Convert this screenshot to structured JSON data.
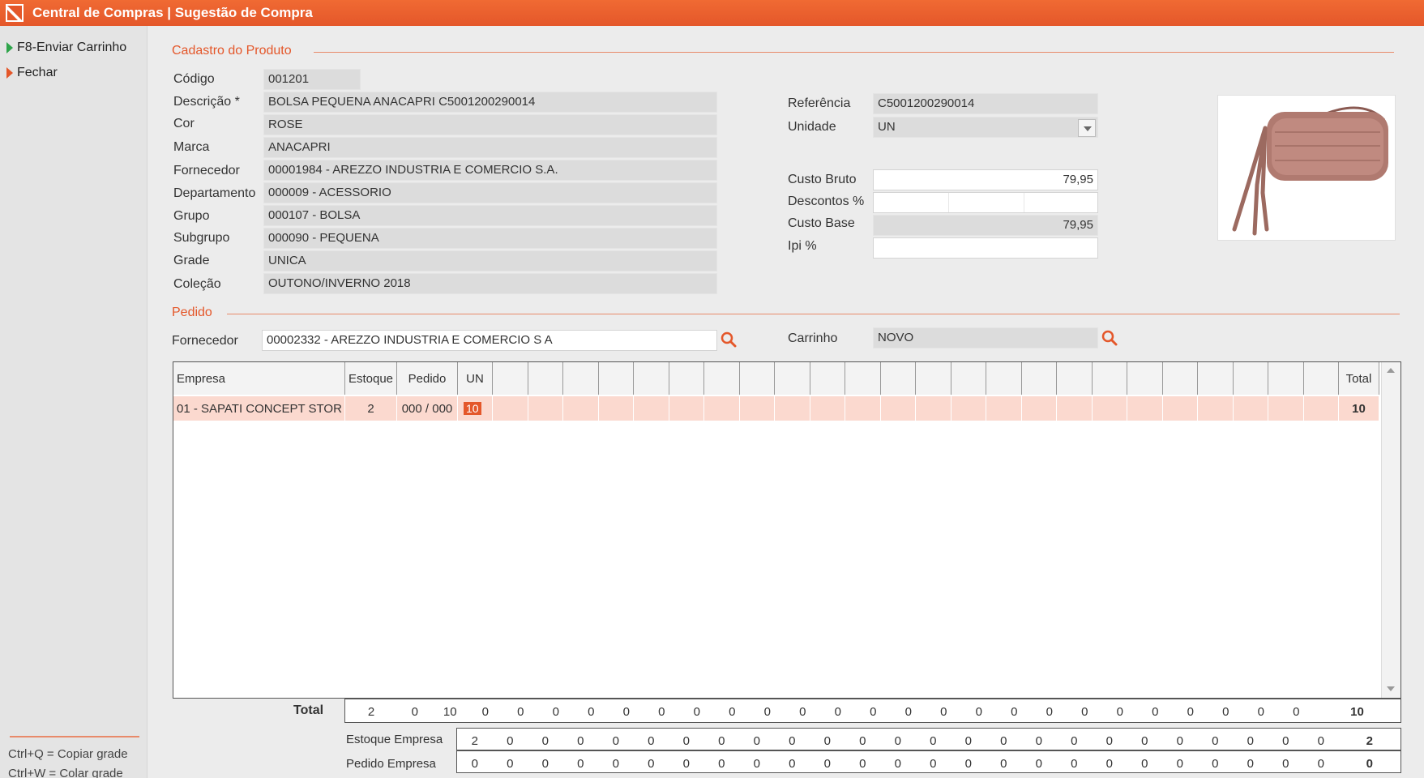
{
  "window": {
    "title": "Central de Compras | Sugestão de Compra"
  },
  "sidebar": {
    "items": [
      {
        "label": "F8-Enviar Carrinho"
      },
      {
        "label": "Fechar"
      }
    ],
    "shortcuts": [
      "Ctrl+Q  = Copiar grade",
      "Ctrl+W = Colar grade"
    ]
  },
  "produto": {
    "section_title": "Cadastro do Produto",
    "codigo_label": "Código",
    "codigo": "001201",
    "descricao_label": "Descrição *",
    "descricao": "BOLSA PEQUENA ANACAPRI C5001200290014",
    "cor_label": "Cor",
    "cor": "ROSE",
    "marca_label": "Marca",
    "marca": "ANACAPRI",
    "fornecedor_label": "Fornecedor",
    "fornecedor": "00001984 - AREZZO INDUSTRIA E COMERCIO S.A.",
    "departamento_label": "Departamento",
    "departamento": "000009 - ACESSORIO",
    "grupo_label": "Grupo",
    "grupo": "000107 - BOLSA",
    "subgrupo_label": "Subgrupo",
    "subgrupo": "000090 - PEQUENA",
    "grade_label": "Grade",
    "grade": "UNICA",
    "colecao_label": "Coleção",
    "colecao": "OUTONO/INVERNO 2018",
    "referencia_label": "Referência",
    "referencia": "C5001200290014",
    "unidade_label": "Unidade",
    "unidade": "UN",
    "custo_bruto_label": "Custo Bruto",
    "custo_bruto": "79,95",
    "descontos_label": "Descontos %",
    "custo_base_label": "Custo Base",
    "custo_base": "79,95",
    "ipi_label": "Ipi %",
    "ipi": ""
  },
  "pedido": {
    "section_title": "Pedido",
    "fornecedor_label": "Fornecedor",
    "fornecedor": "00002332 - AREZZO INDUSTRIA E COMERCIO S A",
    "carrinho_label": "Carrinho",
    "carrinho": "NOVO"
  },
  "grid": {
    "headers": {
      "empresa": "Empresa",
      "estoque": "Estoque",
      "pedido": "Pedido",
      "un": "UN",
      "total": "Total"
    },
    "row": {
      "empresa": "01 - SAPATI CONCEPT STOR",
      "estoque": "2",
      "pedido": "000 / 000",
      "un": "10",
      "total": "10"
    },
    "totals": {
      "label": "Total",
      "values": [
        "2",
        "0",
        "10",
        "0",
        "0",
        "0",
        "0",
        "0",
        "0",
        "0",
        "0",
        "0",
        "0",
        "0",
        "0",
        "0",
        "0",
        "0",
        "0",
        "0",
        "0",
        "0",
        "0",
        "0",
        "0",
        "0",
        "0"
      ],
      "grand_total": "10"
    },
    "estoque_empresa": {
      "label": "Estoque Empresa",
      "values": [
        "2",
        "0",
        "0",
        "0",
        "0",
        "0",
        "0",
        "0",
        "0",
        "0",
        "0",
        "0",
        "0",
        "0",
        "0",
        "0",
        "0",
        "0",
        "0",
        "0",
        "0",
        "0",
        "0",
        "0",
        "0"
      ],
      "total": "2"
    },
    "pedido_empresa": {
      "label": "Pedido Empresa",
      "values": [
        "0",
        "0",
        "0",
        "0",
        "0",
        "0",
        "0",
        "0",
        "0",
        "0",
        "0",
        "0",
        "0",
        "0",
        "0",
        "0",
        "0",
        "0",
        "0",
        "0",
        "0",
        "0",
        "0",
        "0",
        "0"
      ],
      "total": "0"
    }
  },
  "colors": {
    "accent": "#e4572a",
    "row_highlight": "#fbd9cf"
  }
}
